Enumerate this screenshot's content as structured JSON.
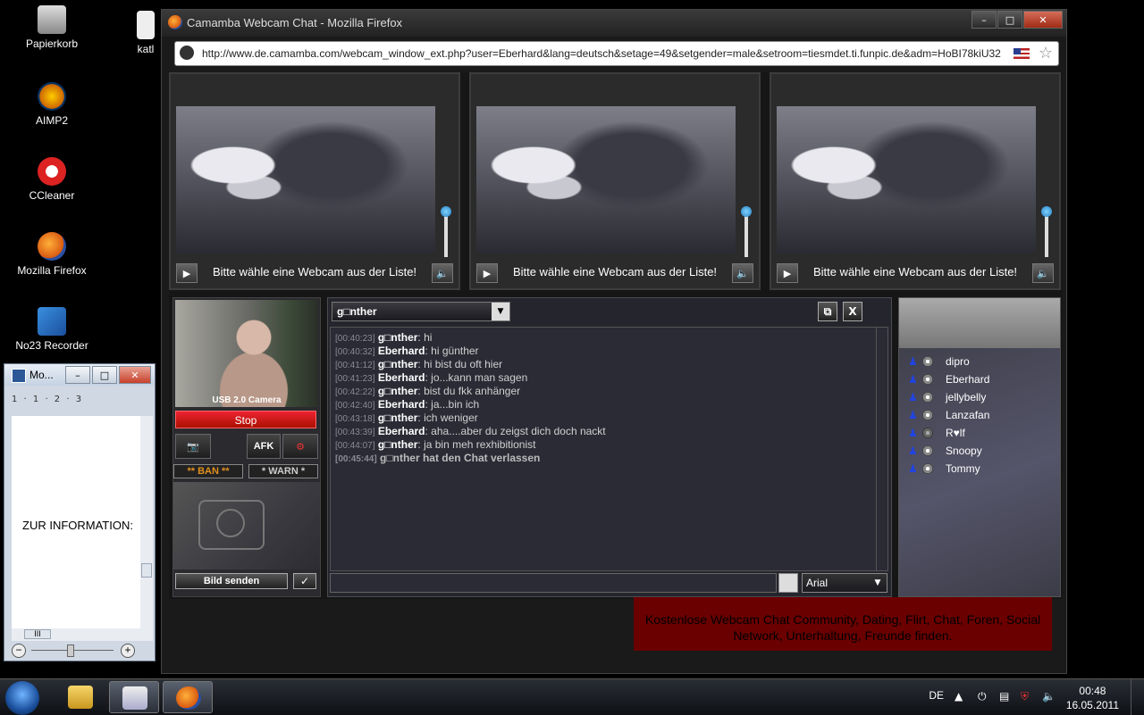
{
  "desktop": {
    "icons": [
      {
        "label": "Papierkorb"
      },
      {
        "label": "AIMP2"
      },
      {
        "label": "CCleaner"
      },
      {
        "label": "Mozilla Firefox"
      },
      {
        "label": "No23 Recorder"
      }
    ],
    "partial_label": "katl"
  },
  "word_window": {
    "title": "Mo...",
    "ruler": "1 · 1 · 2 · 3",
    "content": "ZUR INFORMATION:",
    "hscroll_label": "III"
  },
  "firefox": {
    "title": "Camamba Webcam Chat - Mozilla Firefox",
    "url": "http://www.de.camamba.com/webcam_window_ext.php?user=Eberhard&lang=deutsch&setage=49&setgender=male&setroom=tiesmdet.ti.funpic.de&adm=HoBI78kiU32"
  },
  "cams": [
    {
      "message": "Bitte wähle eine Webcam aus der Liste!"
    },
    {
      "message": "Bitte wähle eine Webcam aus der Liste!"
    },
    {
      "message": "Bitte wähle eine Webcam aus der Liste!"
    }
  ],
  "own_cam": {
    "camera_label": "USB 2.0 Camera",
    "stop": "Stop",
    "afk": "AFK",
    "ban": "** BAN **",
    "warn": "* WARN *",
    "send_image": "Bild senden"
  },
  "chat": {
    "room_select": "g□nther",
    "font": "Arial",
    "lines": [
      {
        "time": "[00:40:23]",
        "nick": "g□nther",
        "text": ": hi"
      },
      {
        "time": "[00:40:32]",
        "nick": "Eberhard",
        "text": ": hi günther"
      },
      {
        "time": "[00:41:12]",
        "nick": "g□nther",
        "text": ": hi  bist du oft hier"
      },
      {
        "time": "[00:41:23]",
        "nick": "Eberhard",
        "text": ": jo...kann man sagen"
      },
      {
        "time": "[00:42:22]",
        "nick": "g□nther",
        "text": ": bist du fkk anhänger"
      },
      {
        "time": "[00:42:40]",
        "nick": "Eberhard",
        "text": ": ja...bin ich"
      },
      {
        "time": "[00:43:18]",
        "nick": "g□nther",
        "text": ": ich weniger"
      },
      {
        "time": "[00:43:39]",
        "nick": "Eberhard",
        "text": ": aha....aber du zeigst dich doch nackt"
      },
      {
        "time": "[00:44:07]",
        "nick": "g□nther",
        "text": ": ja bin meh rexhibitionist"
      },
      {
        "time": "[00:45:44]",
        "nick": "",
        "text": "g□nther hat den Chat verlassen"
      }
    ]
  },
  "users": [
    {
      "name": "dipro",
      "cam": true
    },
    {
      "name": "Eberhard",
      "cam": true
    },
    {
      "name": "jellybelly",
      "cam": true
    },
    {
      "name": "Lanzafan",
      "cam": true
    },
    {
      "name": "R♥lf",
      "cam": false
    },
    {
      "name": "Snoopy",
      "cam": true
    },
    {
      "name": "Tommy",
      "cam": true
    }
  ],
  "ad_text": "Kostenlose Webcam Chat Community, Dating, Flirt, Chat, Foren, Social Network, Unterhaltung, Freunde finden.",
  "taskbar": {
    "lang": "DE",
    "time": "00:48",
    "date": "16.05.2011"
  },
  "colors": {
    "ad_background": "#6a0000",
    "stop_button": "#dd2233",
    "ban_text": "#e09020"
  }
}
